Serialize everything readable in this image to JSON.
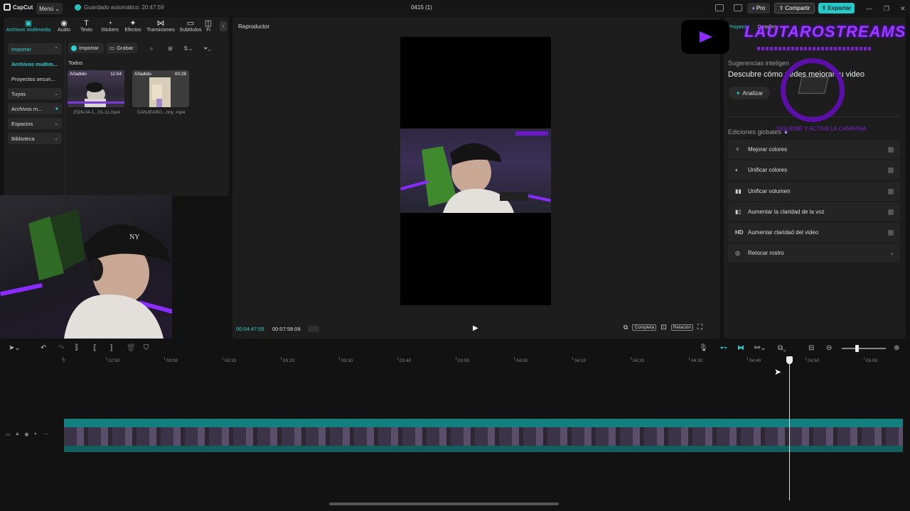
{
  "titlebar": {
    "app_name": "CapCut",
    "menu_label": "Menú",
    "autosave": "Guardado automático: 20:47:59",
    "project_title": "0415 (1)",
    "pro_label": "Pro",
    "share_label": "Compartir",
    "export_label": "Exportar"
  },
  "top_tabs": [
    {
      "label": "Archivos multimedia",
      "icon": "▣"
    },
    {
      "label": "Audio",
      "icon": "◉"
    },
    {
      "label": "Texto",
      "icon": "T"
    },
    {
      "label": "Stickers",
      "icon": "◔"
    },
    {
      "label": "Efectos",
      "icon": "✦"
    },
    {
      "label": "Transiciones",
      "icon": "⋈"
    },
    {
      "label": "Subtítulos",
      "icon": "▭"
    },
    {
      "label": "Fi",
      "icon": "◫"
    }
  ],
  "side_menu": [
    {
      "label": "Importar"
    },
    {
      "label": "Archivos multim..."
    },
    {
      "label": "Proyectos secun..."
    },
    {
      "label": "Tuyos"
    },
    {
      "label": "Archivos m..."
    },
    {
      "label": "Espacios"
    },
    {
      "label": "Biblioteca"
    }
  ],
  "media": {
    "import_label": "Importar",
    "record_label": "Grabar",
    "all_label": "Todos",
    "items": [
      {
        "tag": "Añadido",
        "duration": "11:54",
        "name": "2026-04-1...01-11.mp4"
      },
      {
        "tag": "Añadido",
        "duration": "00:28",
        "name": "CANJEARO...nny .mp4"
      }
    ]
  },
  "player": {
    "title": "Reproductor",
    "current_time": "00:04:47:05",
    "total_time": "00:07:58:08",
    "full_label": "Completa",
    "ratio_label": "Relación"
  },
  "right_panel": {
    "tab_project": "Proyecto",
    "tab_details": "Detalles",
    "suggest_title": "Sugerencias inteligen",
    "suggest_desc": "Descubre cómo    uedes mejorar tu video",
    "analyze_label": "Analizar",
    "global_title": "Ediciones globales",
    "global_items": [
      {
        "icon": "✧",
        "label": "Mejorar colores",
        "type": "toggle"
      },
      {
        "icon": "◐",
        "label": "Unificar colores",
        "type": "toggle"
      },
      {
        "icon": "▮▮",
        "label": "Unificar volumen",
        "type": "toggle"
      },
      {
        "icon": "▮▯",
        "label": "Aumentar la claridad de la voz",
        "type": "toggle"
      },
      {
        "icon": "HD",
        "label": "Aumentar claridad del video",
        "type": "toggle"
      },
      {
        "icon": "◎",
        "label": "Retocar rostro",
        "type": "arrow"
      }
    ]
  },
  "overlay": {
    "channel_name": "LAUTAROSTREAMS",
    "ring_text": "SIGUEME Y ACTIVA LA CAMPANA"
  },
  "timeline": {
    "ruler": [
      "0",
      "02:50",
      "03:00",
      "03:10",
      "03:20",
      "03:30",
      "03:40",
      "03:50",
      "04:00",
      "04:10",
      "04:20",
      "04:30",
      "04:40",
      "04:50",
      "05:00"
    ]
  },
  "colors": {
    "accent": "#2fd0d0",
    "clip": "#137f7f",
    "export": "#27c8c8",
    "overlay_purple": "#9b3bff"
  }
}
